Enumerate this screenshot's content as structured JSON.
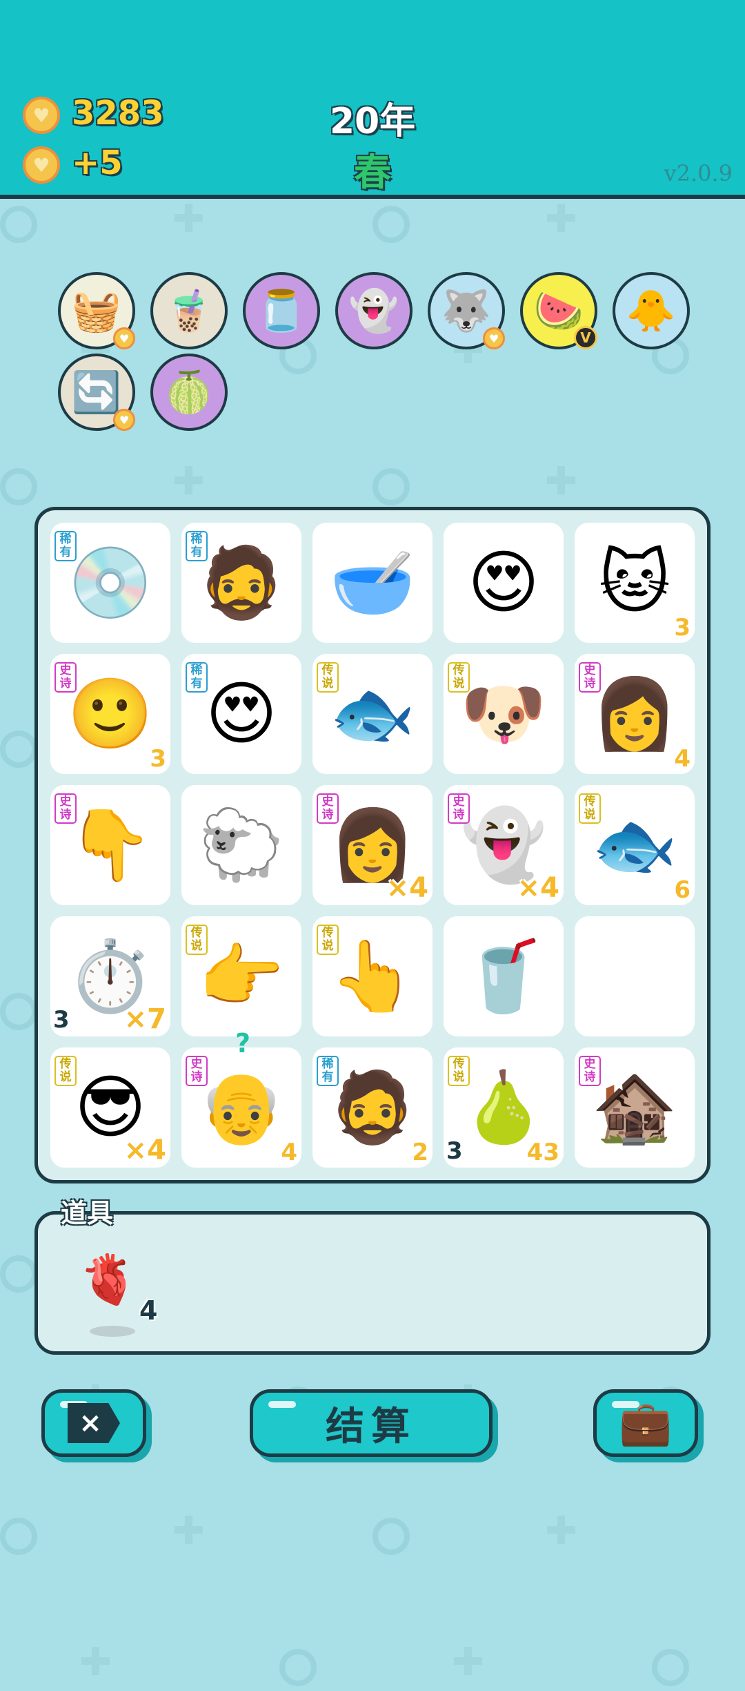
{
  "header": {
    "coins": "3283",
    "income": "+5",
    "year": "20年",
    "season": "春",
    "version": "v2.0.9"
  },
  "relics": [
    {
      "icon": "fruit-basket",
      "glyph": "🧺",
      "bg": "#f1f0dc",
      "badge": "heart"
    },
    {
      "icon": "bubble-tea-mushroom",
      "glyph": "🧋",
      "bg": "#e8e2d2",
      "badge": ""
    },
    {
      "icon": "jar",
      "glyph": "🫙",
      "bg": "#c79be3",
      "badge": ""
    },
    {
      "icon": "traffic-ghost",
      "glyph": "👻",
      "bg": "#c79be3",
      "badge": ""
    },
    {
      "icon": "husky",
      "glyph": "🐺",
      "bg": "#b9e2f2",
      "badge": "heart"
    },
    {
      "icon": "fruit-platter",
      "glyph": "🍉",
      "bg": "#f6ef4e",
      "badge": "v"
    },
    {
      "icon": "chick-egg",
      "glyph": "🐥",
      "bg": "#b9e2f2",
      "badge": ""
    },
    {
      "icon": "refresh",
      "glyph": "🔄",
      "bg": "#e8e2d2",
      "badge": "heart"
    },
    {
      "icon": "pomelo",
      "glyph": "🍈",
      "bg": "#c79be3",
      "badge": ""
    }
  ],
  "board": [
    {
      "tag": "稀有",
      "tier": "rare",
      "glyph": "💿",
      "name": "cd-disc",
      "br": "",
      "bl": ""
    },
    {
      "tag": "稀有",
      "tier": "rare",
      "glyph": "🧔",
      "name": "bucket-hat-man",
      "br": "",
      "bl": ""
    },
    {
      "tag": "",
      "tier": "",
      "glyph": "🥣",
      "name": "soup-bowl",
      "br": "",
      "bl": ""
    },
    {
      "tag": "",
      "tier": "",
      "glyph": "😍",
      "name": "bald-man-heart-eyes",
      "br": "",
      "bl": ""
    },
    {
      "tag": "",
      "tier": "",
      "glyph": "🐱",
      "name": "yellow-cat",
      "br": "3",
      "bl": ""
    },
    {
      "tag": "史诗",
      "tier": "epic",
      "glyph": "🙂",
      "name": "yellow-face",
      "br": "3",
      "bl": ""
    },
    {
      "tag": "稀有",
      "tier": "rare",
      "glyph": "😍",
      "name": "bucket-hat-man-heart-eyes",
      "br": "",
      "bl": ""
    },
    {
      "tag": "传说",
      "tier": "legend",
      "glyph": "🐟",
      "name": "koi-fish",
      "br": "",
      "bl": ""
    },
    {
      "tag": "传说",
      "tier": "legend",
      "glyph": "🐶",
      "name": "husky-king",
      "br": "",
      "bl": ""
    },
    {
      "tag": "史诗",
      "tier": "epic",
      "glyph": "👩",
      "name": "braided-girl",
      "br": "4",
      "bl": ""
    },
    {
      "tag": "史诗",
      "tier": "epic",
      "glyph": "👇",
      "name": "pointing-hand-grey",
      "br": "",
      "bl": ""
    },
    {
      "tag": "",
      "tier": "",
      "glyph": "🐑",
      "name": "sheep",
      "br": "",
      "bl": ""
    },
    {
      "tag": "史诗",
      "tier": "epic",
      "glyph": "👩",
      "name": "braided-girl-2",
      "br": "×4",
      "bl": ""
    },
    {
      "tag": "史诗",
      "tier": "epic",
      "glyph": "👻",
      "name": "ghost-heart-eyes",
      "br": "×4",
      "bl": ""
    },
    {
      "tag": "传说",
      "tier": "legend",
      "glyph": "🐟",
      "name": "koi-fish-2",
      "br": "6",
      "bl": ""
    },
    {
      "tag": "",
      "tier": "",
      "glyph": "⏱️",
      "name": "stopwatch-card",
      "br": "×7",
      "bl": "3"
    },
    {
      "tag": "传说",
      "tier": "legend",
      "glyph": "👉",
      "name": "pointing-hand-right",
      "br": "",
      "bl": ""
    },
    {
      "tag": "传说",
      "tier": "legend",
      "glyph": "👆",
      "name": "pointing-hand-up",
      "br": "",
      "bl": ""
    },
    {
      "tag": "",
      "tier": "",
      "glyph": "🥤",
      "name": "soda-cup",
      "br": "",
      "bl": ""
    },
    {
      "tag": "",
      "tier": "",
      "glyph": "",
      "name": "empty-slot",
      "br": "",
      "bl": ""
    },
    {
      "tag": "传说",
      "tier": "legend",
      "glyph": "😎",
      "name": "pink-glasses-face",
      "br": "×4",
      "bl": ""
    },
    {
      "tag": "史诗",
      "tier": "epic",
      "glyph": "👴",
      "name": "green-cap-grandpa",
      "br": "4",
      "bl": "",
      "q": "?"
    },
    {
      "tag": "稀有",
      "tier": "rare",
      "glyph": "🧔",
      "name": "bucket-hat-man-2",
      "br": "2",
      "bl": ""
    },
    {
      "tag": "传说",
      "tier": "legend",
      "glyph": "🍐",
      "name": "pear-branch",
      "br": "43",
      "bl": "3"
    },
    {
      "tag": "史诗",
      "tier": "epic",
      "glyph": "🏚️",
      "name": "haunted-house",
      "br": "",
      "bl": ""
    }
  ],
  "items": {
    "title": "道具",
    "list": [
      {
        "icon": "liver",
        "glyph": "🫀",
        "count": "4"
      }
    ]
  },
  "buttons": {
    "skip": "×",
    "settle": "结算",
    "bag": "💼"
  },
  "colors": {
    "header_bg": "#15c2c6",
    "page_bg": "#a9dfe6",
    "outline": "#1d3b45",
    "gold": "#fbd234",
    "season_green": "#2ec76b"
  }
}
